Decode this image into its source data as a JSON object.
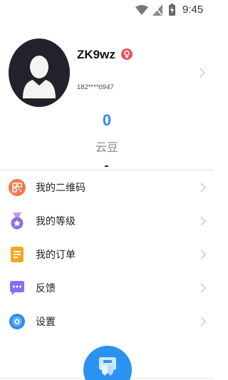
{
  "status_bar": {
    "time": "9:45",
    "icons": [
      "wifi-icon",
      "no-signal-icon",
      "battery-charging-icon"
    ]
  },
  "profile": {
    "username": "ZK9wz",
    "gender_icon": "female-icon",
    "phone": "182****0947",
    "avatar_icon": "default-avatar-icon"
  },
  "points": {
    "value": "0",
    "label": "云豆"
  },
  "menu": {
    "items": [
      {
        "label": "我的二维码",
        "icon": "qr-code-icon",
        "color": "#f07a4f"
      },
      {
        "label": "我的等级",
        "icon": "medal-icon",
        "color": "#8e6ee0"
      },
      {
        "label": "我的订单",
        "icon": "order-icon",
        "color": "#f5a623"
      },
      {
        "label": "反馈",
        "icon": "feedback-icon",
        "color": "#8c6cf0"
      },
      {
        "label": "设置",
        "icon": "settings-icon",
        "color": "#2e8de6"
      }
    ]
  },
  "colors": {
    "accent": "#2f8be8",
    "avatar_bg": "#23212b",
    "badge": "#e9525a"
  }
}
